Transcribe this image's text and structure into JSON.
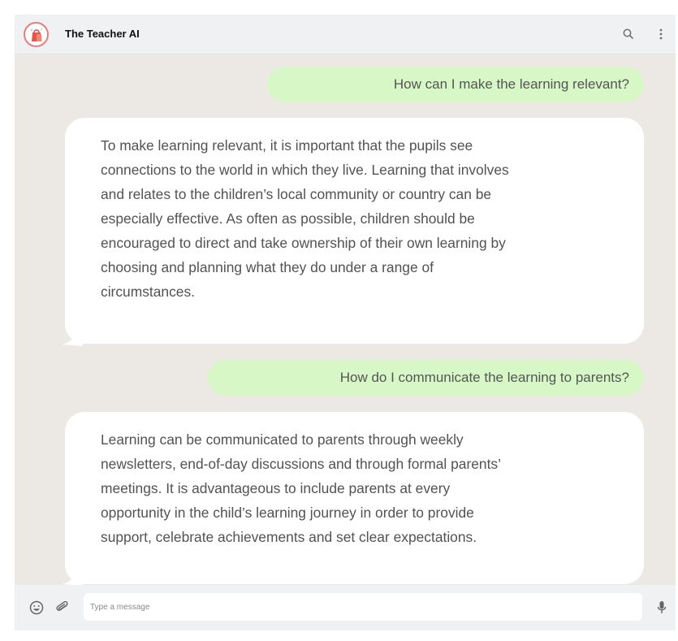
{
  "header": {
    "title": "The Teacher AI",
    "avatar_icon": "shopping-bag-logo-icon",
    "search_icon": "search-icon",
    "menu_icon": "more-vertical-icon"
  },
  "messages": [
    {
      "role": "user",
      "text": "How can I make the learning relevant?"
    },
    {
      "role": "assistant",
      "lines": [
        "To make learning relevant, it is important that the pupils see",
        "connections to the world in which they live. Learning that involves",
        "and relates to the children’s local community or country can be",
        "especially effective. As often as possible, children should be",
        "encouraged to direct and take ownership of their own learning by",
        "choosing and planning what they do under a range of",
        "circumstances."
      ]
    },
    {
      "role": "user",
      "text": "How do I communicate the learning to parents?"
    },
    {
      "role": "assistant",
      "lines": [
        "Learning can be communicated to parents through weekly",
        "newsletters, end-of-day discussions and through formal parents’",
        "meetings. It is advantageous to include parents at every",
        "opportunity in the child’s learning journey in order to provide",
        "support, celebrate achievements and set clear expectations."
      ]
    }
  ],
  "composer": {
    "placeholder": "Type a message",
    "emoji_icon": "emoji-icon",
    "attach_icon": "paperclip-icon",
    "mic_icon": "microphone-icon"
  },
  "colors": {
    "chat_background": "#ece9e4",
    "user_bubble": "#d7f8c6",
    "assistant_bubble": "#ffffff",
    "header_footer": "#f0f1f3"
  }
}
